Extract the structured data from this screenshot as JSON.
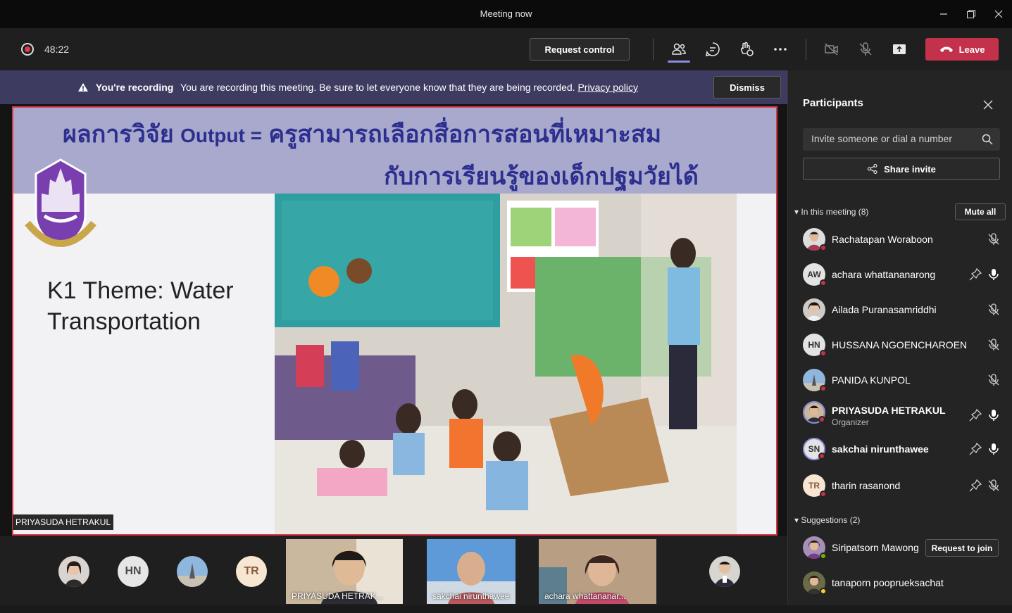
{
  "window": {
    "title": "Meeting now"
  },
  "toolbar": {
    "timer": "48:22",
    "request_control": "Request control",
    "leave": "Leave"
  },
  "banner": {
    "strong": "You're recording",
    "message": "You are recording this meeting. Be sure to let everyone know that they are being recorded.",
    "link": "Privacy policy",
    "dismiss": "Dismiss"
  },
  "slide": {
    "thai_part1": "ผลการวิจัย",
    "output": "Output =",
    "thai_part2": "ครูสามารถเลือกสื่อการสอนที่เหมาะสม",
    "thai_line2": "กับการเรียนรู้ของเด็กปฐมวัยได้",
    "theme_line1": "K1  Theme: Water",
    "theme_line2": "Transportation",
    "presenter": "PRIYASUDA HETRAKUL"
  },
  "gallery": {
    "avatars": [
      "HN",
      "TR"
    ],
    "tiles": [
      {
        "label": "PRIYASUDA HETRAK..."
      },
      {
        "label": "sakchai nirunthawee"
      },
      {
        "label": "achara whattananar..."
      }
    ]
  },
  "panel": {
    "title": "Participants",
    "invite_placeholder": "Invite someone or dial a number",
    "share_invite": "Share invite",
    "in_meeting": "In this meeting (8)",
    "mute_all": "Mute all",
    "participants": [
      {
        "name": "Rachatapan Woraboon",
        "initials": "",
        "role": ""
      },
      {
        "name": "achara whattananarong",
        "initials": "AW",
        "role": ""
      },
      {
        "name": "Ailada Puranasamriddhi",
        "initials": "",
        "role": ""
      },
      {
        "name": "HUSSANA NGOENCHAROEN",
        "initials": "HN",
        "role": ""
      },
      {
        "name": "PANIDA KUNPOL",
        "initials": "",
        "role": ""
      },
      {
        "name": "PRIYASUDA HETRAKUL",
        "initials": "",
        "role": "Organizer"
      },
      {
        "name": "sakchai nirunthawee",
        "initials": "SN",
        "role": ""
      },
      {
        "name": "tharin rasanond",
        "initials": "TR",
        "role": ""
      }
    ],
    "suggestions": "Suggestions (2)",
    "suggested": [
      {
        "name": "Siripatsorn Mawong",
        "action": "Request to join"
      },
      {
        "name": "tanaporn pooprueksachat"
      }
    ]
  },
  "colors": {
    "leave": "#c4314b",
    "banner": "#3e3b61",
    "accent": "#8b8cd9"
  }
}
